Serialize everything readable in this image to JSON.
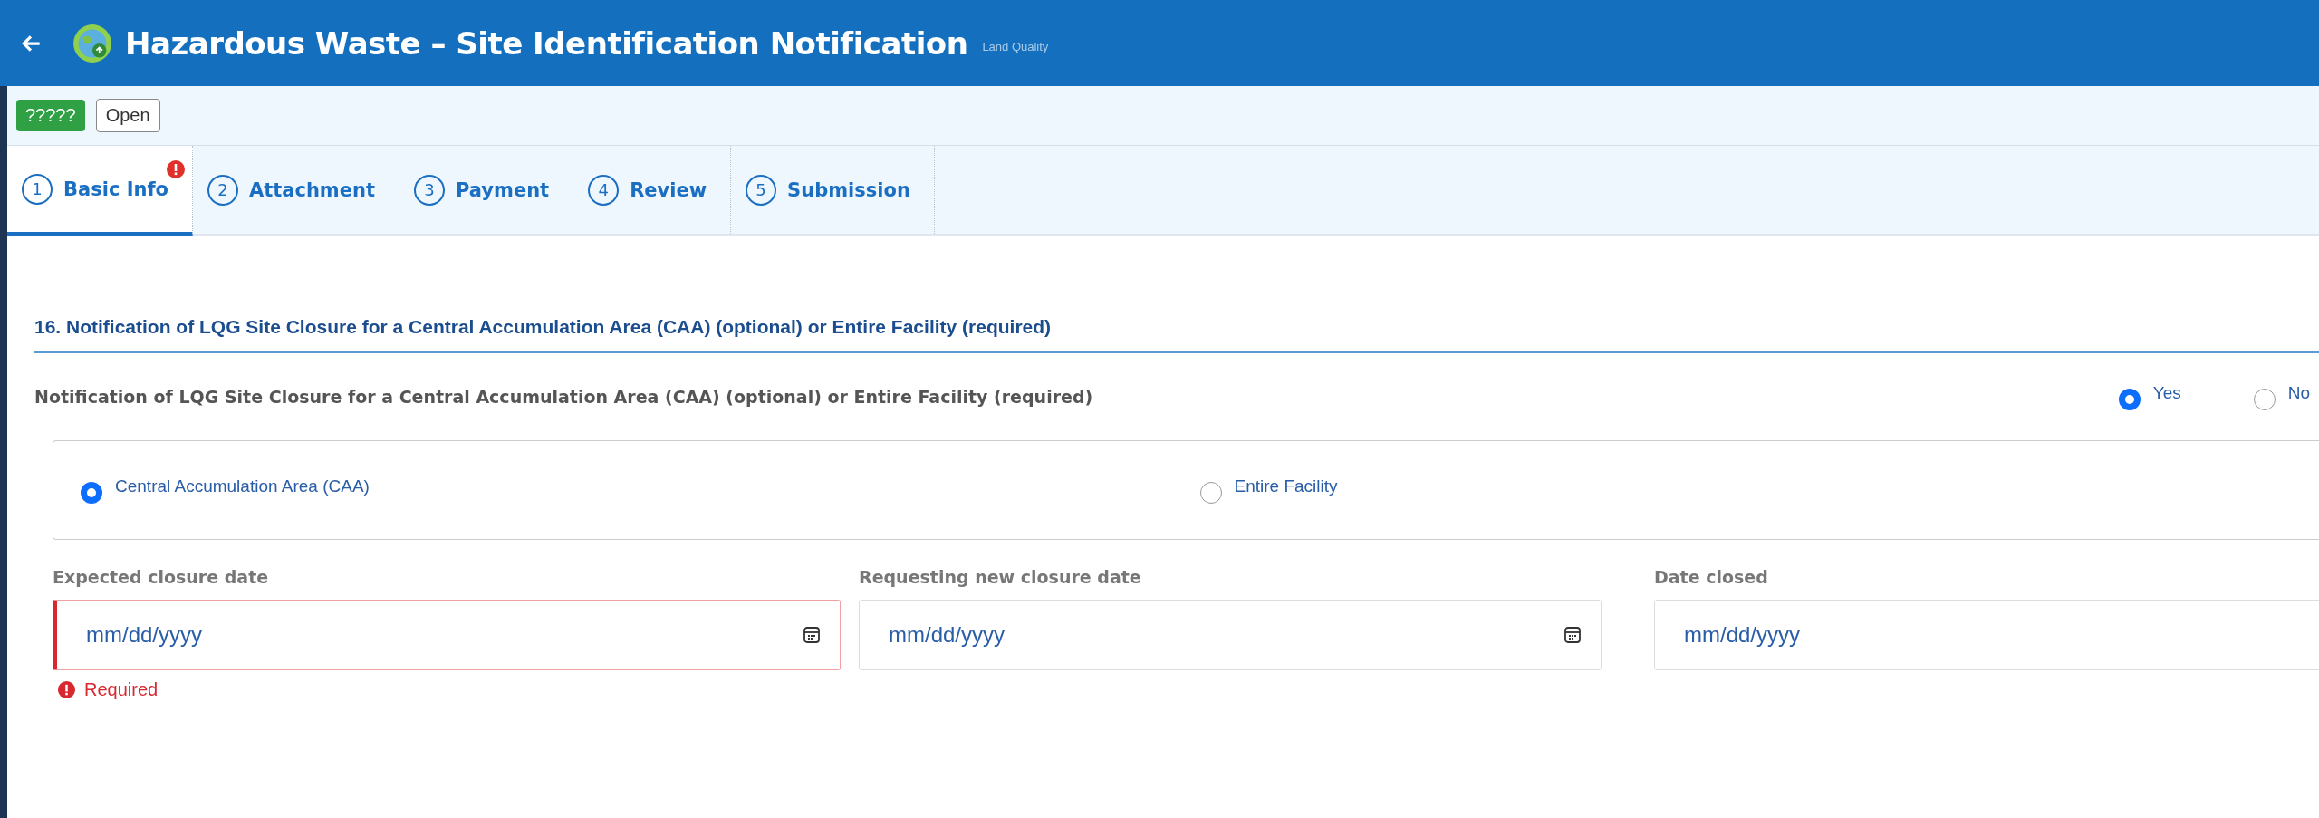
{
  "header": {
    "title": "Hazardous Waste – Site Identification Notification",
    "subtitle": "Land Quality"
  },
  "badges": [
    {
      "label": "?????",
      "kind": "status"
    },
    {
      "label": "Open",
      "kind": "outline"
    }
  ],
  "tabs": [
    {
      "number": "1",
      "label": "Basic Info",
      "selected": true,
      "error": true
    },
    {
      "number": "2",
      "label": "Attachment",
      "selected": false,
      "error": false
    },
    {
      "number": "3",
      "label": "Payment",
      "selected": false,
      "error": false
    },
    {
      "number": "4",
      "label": "Review",
      "selected": false,
      "error": false
    },
    {
      "number": "5",
      "label": "Submission",
      "selected": false,
      "error": false
    }
  ],
  "section": {
    "heading": "16. Notification of LQG Site Closure for a Central Accumulation Area (CAA) (optional) or Entire Facility (required)",
    "question": "Notification of LQG Site Closure for a Central Accumulation Area (CAA) (optional) or Entire Facility (required)",
    "answers": [
      {
        "label": "Yes",
        "selected": true
      },
      {
        "label": "No",
        "selected": false
      }
    ],
    "closure_types": [
      {
        "label": "Central Accumulation Area (CAA)",
        "selected": true
      },
      {
        "label": "Entire Facility",
        "selected": false
      }
    ],
    "date_fields": [
      {
        "label": "Expected closure date",
        "placeholder": "mm/dd/yyyy",
        "error": true,
        "error_text": "Required",
        "calendar_icon": true
      },
      {
        "label": "Requesting new closure date",
        "placeholder": "mm/dd/yyyy",
        "error": false,
        "calendar_icon": true
      },
      {
        "label": "Date closed",
        "placeholder": "mm/dd/yyyy",
        "error": false,
        "calendar_icon": false
      }
    ]
  }
}
